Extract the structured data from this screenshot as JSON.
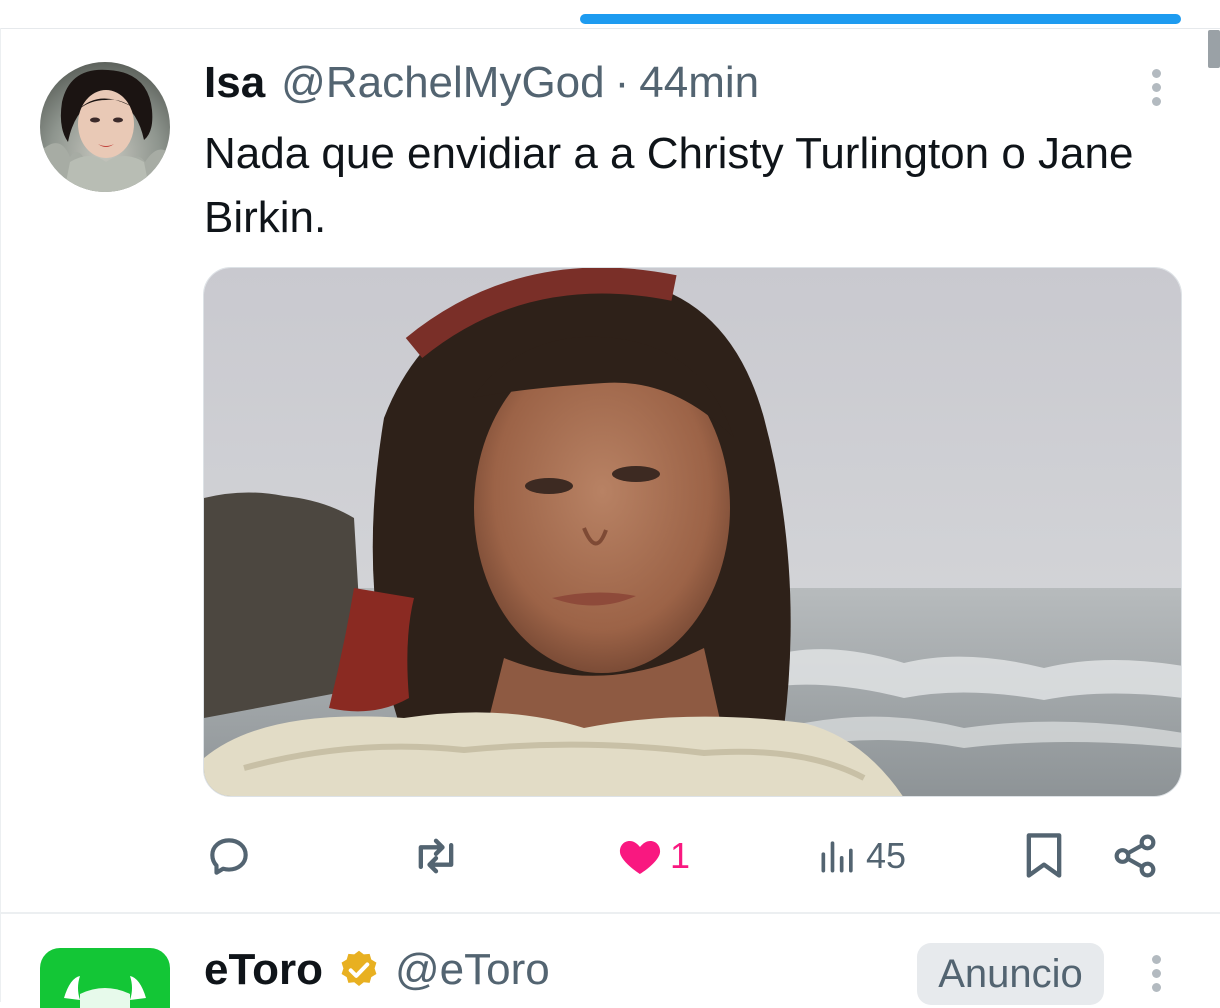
{
  "tweet": {
    "author_name": "Isa",
    "handle": "@RachelMyGod",
    "separator": "·",
    "time": "44min",
    "text": "Nada que envidiar a a Christy Turlington o Jane Birkin.",
    "stats": {
      "like_count": "1",
      "views_count": "45"
    },
    "liked": true,
    "accent_color": "#1d9bf0",
    "like_color": "#f91880"
  },
  "ad": {
    "author_name": "eToro",
    "handle": "@eToro",
    "badge": "Anuncio",
    "verified_color": "#e8b021",
    "logo_color": "#13c636"
  },
  "icons": {
    "reply": "reply-icon",
    "retweet": "retweet-icon",
    "like": "heart-icon",
    "views": "views-icon",
    "bookmark": "bookmark-icon",
    "share": "share-icon",
    "more": "more-vertical-icon",
    "verified": "verified-badge-icon"
  }
}
